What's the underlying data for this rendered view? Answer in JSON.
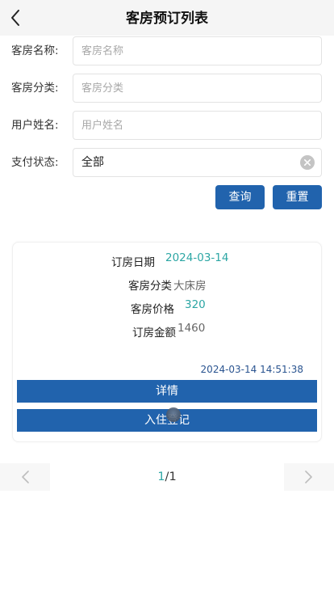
{
  "header": {
    "title": "客房预订列表",
    "back_icon": "chevron-left-icon"
  },
  "search_form": {
    "room_name": {
      "label": "客房名称:",
      "placeholder": "客房名称",
      "value": ""
    },
    "room_category": {
      "label": "客房分类:",
      "placeholder": "客房分类",
      "value": ""
    },
    "user_name": {
      "label": "用户姓名:",
      "placeholder": "用户姓名",
      "value": ""
    },
    "payment_status": {
      "label": "支付状态:",
      "selected": "全部",
      "clear_icon": "clear-circle-icon"
    },
    "query_label": "查询",
    "reset_label": "重置"
  },
  "booking_card": {
    "booking_date_label": "订房日期",
    "booking_date_value": "2024-03-14",
    "room_category_label": "客房分类",
    "room_category_value": "大床房",
    "room_price_label": "客房价格",
    "room_price_value": "320",
    "booking_amount_label": "订房金额",
    "booking_amount_value": "1460",
    "created_time": "2024-03-14 14:51:38",
    "detail_label": "详情",
    "checkin_label": "入住登记"
  },
  "pagination": {
    "current_page": "1",
    "separator": "/",
    "total_pages": "1",
    "prev_icon": "chevron-left-icon",
    "next_icon": "chevron-right-icon"
  },
  "colors": {
    "primary": "#2163ad",
    "value_teal": "#2ca6a4",
    "value_gray": "#666666",
    "timestamp": "#2a5490"
  }
}
